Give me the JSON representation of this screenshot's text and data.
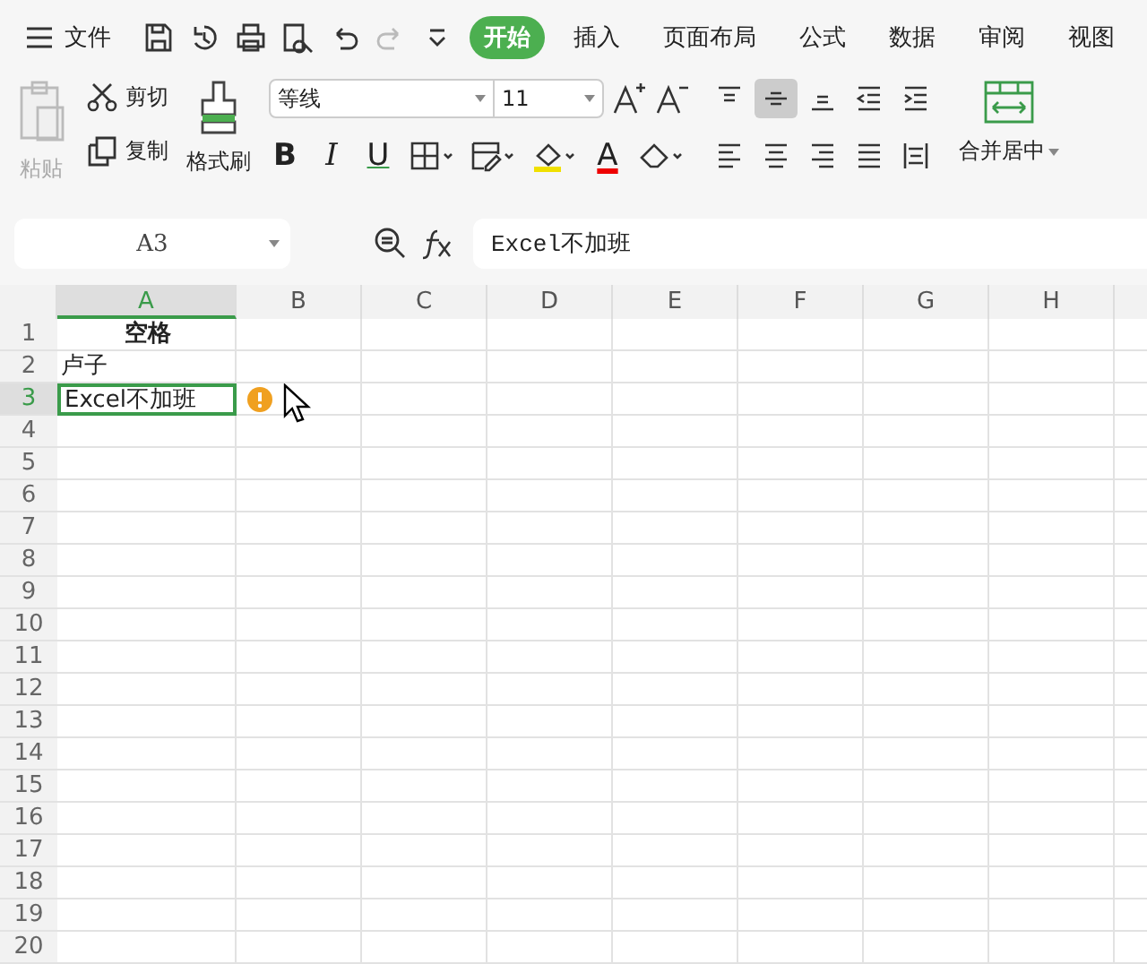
{
  "menu": {
    "file_label": "文件"
  },
  "quick_access": [
    {
      "kind": "save",
      "disabled": false
    },
    {
      "kind": "history",
      "disabled": false
    },
    {
      "kind": "print",
      "disabled": false
    },
    {
      "kind": "preview",
      "disabled": false
    },
    {
      "kind": "undo",
      "disabled": false
    },
    {
      "kind": "redo",
      "disabled": true
    },
    {
      "kind": "more",
      "disabled": false
    }
  ],
  "tabs": [
    {
      "label": "开始",
      "selected": true
    },
    {
      "label": "插入",
      "selected": false
    },
    {
      "label": "页面布局",
      "selected": false
    },
    {
      "label": "公式",
      "selected": false
    },
    {
      "label": "数据",
      "selected": false
    },
    {
      "label": "审阅",
      "selected": false
    },
    {
      "label": "视图",
      "selected": false
    }
  ],
  "clipboard": {
    "paste": {
      "label": "粘贴",
      "disabled": true
    },
    "cut": "剪切",
    "copy": "复制",
    "format_painter": "格式刷"
  },
  "font": {
    "name": "等线",
    "size": "11"
  },
  "font_tools": [
    {
      "kind": "bold",
      "label": "B"
    },
    {
      "kind": "italic",
      "label": "I"
    },
    {
      "kind": "underline",
      "label": "U"
    },
    {
      "kind": "border"
    },
    {
      "kind": "cellstyle"
    },
    {
      "kind": "fill"
    },
    {
      "kind": "color",
      "label": "A"
    },
    {
      "kind": "eraser"
    }
  ],
  "align_top": [
    {
      "kind": "top",
      "selected": false
    },
    {
      "kind": "middle",
      "selected": true
    },
    {
      "kind": "bottom",
      "selected": false
    },
    {
      "kind": "outdent",
      "selected": false
    },
    {
      "kind": "indent",
      "selected": false
    }
  ],
  "align_bottom": [
    {
      "kind": "left",
      "selected": false
    },
    {
      "kind": "center",
      "selected": false
    },
    {
      "kind": "right",
      "selected": false
    },
    {
      "kind": "justify",
      "selected": false
    },
    {
      "kind": "distributed",
      "selected": false
    }
  ],
  "merge": {
    "label": "合并居中"
  },
  "formula_bar": {
    "name_box": "A3",
    "value": "Excel不加班"
  },
  "sheet": {
    "columns": [
      {
        "label": "A",
        "selected": true
      },
      {
        "label": "B",
        "selected": false
      },
      {
        "label": "C",
        "selected": false
      },
      {
        "label": "D",
        "selected": false
      },
      {
        "label": "E",
        "selected": false
      },
      {
        "label": "F",
        "selected": false
      },
      {
        "label": "G",
        "selected": false
      },
      {
        "label": "H",
        "selected": false
      }
    ],
    "rows": [
      {
        "label": "1",
        "selected": false,
        "cells": [
          {
            "text": "空格",
            "bold": true,
            "center": true
          }
        ]
      },
      {
        "label": "2",
        "selected": false,
        "cells": [
          {
            "text": "卢子",
            "bold": false,
            "center": false
          }
        ]
      },
      {
        "label": "3",
        "selected": true,
        "cells": [
          {
            "text": "Excel不加班",
            "bold": false,
            "center": false,
            "selected": true,
            "warning": true
          }
        ]
      },
      {
        "label": "4",
        "selected": false,
        "cells": []
      },
      {
        "label": "5",
        "selected": false,
        "cells": []
      },
      {
        "label": "6",
        "selected": false,
        "cells": []
      },
      {
        "label": "7",
        "selected": false,
        "cells": []
      },
      {
        "label": "8",
        "selected": false,
        "cells": []
      },
      {
        "label": "9",
        "selected": false,
        "cells": []
      },
      {
        "label": "10",
        "selected": false,
        "cells": []
      },
      {
        "label": "11",
        "selected": false,
        "cells": []
      },
      {
        "label": "12",
        "selected": false,
        "cells": []
      },
      {
        "label": "13",
        "selected": false,
        "cells": []
      },
      {
        "label": "14",
        "selected": false,
        "cells": []
      },
      {
        "label": "15",
        "selected": false,
        "cells": []
      },
      {
        "label": "16",
        "selected": false,
        "cells": []
      },
      {
        "label": "17",
        "selected": false,
        "cells": []
      },
      {
        "label": "18",
        "selected": false,
        "cells": []
      },
      {
        "label": "19",
        "selected": false,
        "cells": []
      },
      {
        "label": "20",
        "selected": false,
        "cells": []
      }
    ]
  }
}
